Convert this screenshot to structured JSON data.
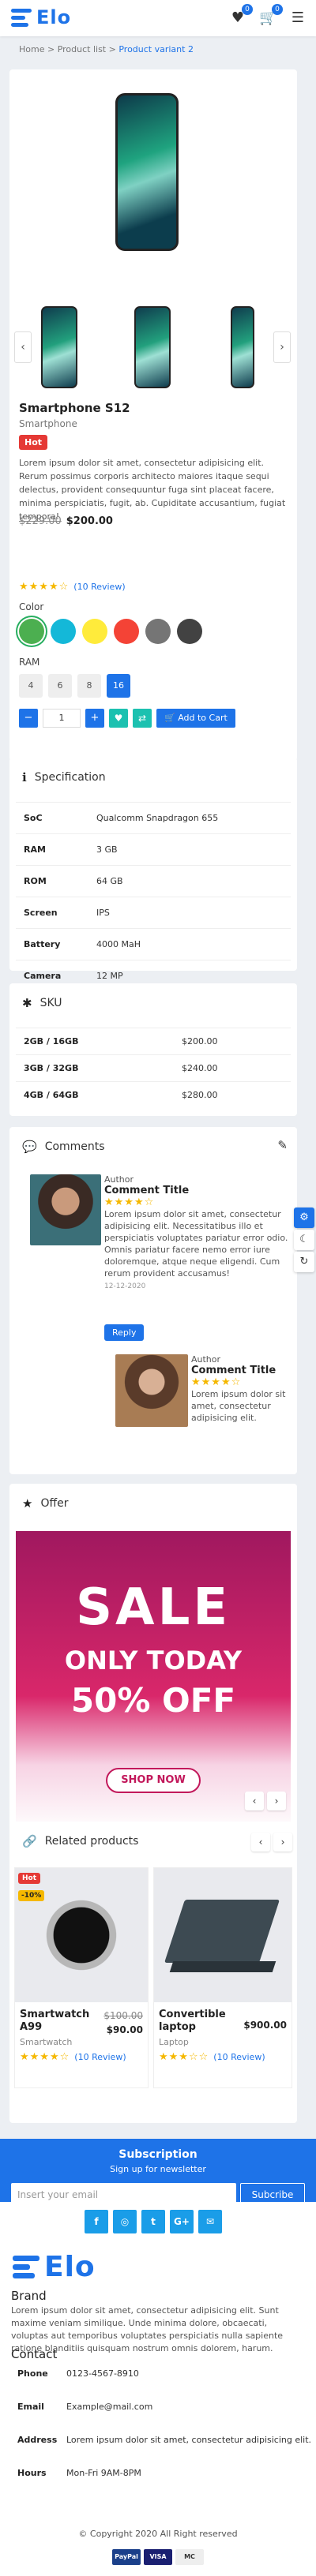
{
  "header": {
    "logo": "Elo",
    "wishlist_count": "0",
    "cart_count": "0"
  },
  "breadcrumb": {
    "home": "Home",
    "list": "Product list",
    "current": "Product variant 2"
  },
  "product": {
    "title": "Smartphone S12",
    "category": "Smartphone",
    "badge": "Hot",
    "description": "Lorem ipsum dolor sit amet, consectetur adipisicing elit. Rerum possimus corporis architecto maiores itaque sequi delectus, provident consequuntur fuga sint placeat facere, minima perspiciatis, fugit, ab. Cupiditate accusantium, fugiat tempora!",
    "old_price": "$229.00",
    "price": "$200.00",
    "rating": 4,
    "reviews": "(10 Review)",
    "color_label": "Color",
    "colors": [
      "#4caf50",
      "#14b8d8",
      "#ffeb3b",
      "#f44336",
      "#757575",
      "#424242"
    ],
    "ram_label": "RAM",
    "ram_options": [
      "4",
      "6",
      "8",
      "16"
    ],
    "ram_selected": "16",
    "quantity": "1",
    "add_to_cart": "Add to Cart"
  },
  "specification": {
    "title": "Specification",
    "rows": [
      {
        "k": "SoC",
        "v": "Qualcomm Snapdragon 655"
      },
      {
        "k": "RAM",
        "v": "3 GB"
      },
      {
        "k": "ROM",
        "v": "64 GB"
      },
      {
        "k": "Screen",
        "v": "IPS"
      },
      {
        "k": "Battery",
        "v": "4000 MaH"
      },
      {
        "k": "Camera",
        "v": "12 MP"
      }
    ]
  },
  "sku": {
    "title": "SKU",
    "rows": [
      {
        "k": "2GB / 16GB",
        "v": "$200.00"
      },
      {
        "k": "3GB / 32GB",
        "v": "$240.00"
      },
      {
        "k": "4GB / 64GB",
        "v": "$280.00"
      }
    ]
  },
  "comments": {
    "title": "Comments",
    "items": [
      {
        "author": "Author",
        "title": "Comment Title",
        "rating": 4,
        "text": "Lorem ipsum dolor sit amet, consectetur adipisicing elit. Necessitatibus illo et perspiciatis voluptates pariatur error odio. Omnis pariatur facere nemo error iure doloremque, atque neque eligendi. Cum rerum provident accusamus!",
        "date": "12-12-2020",
        "reply": "Reply"
      },
      {
        "author": "Author",
        "title": "Comment Title",
        "rating": 4,
        "text": "Lorem ipsum dolor sit amet, consectetur adipisicing elit."
      }
    ]
  },
  "offer": {
    "title": "Offer",
    "line1": "SALE",
    "line2": "ONLY TODAY",
    "line3": "50% OFF",
    "cta": "SHOP NOW"
  },
  "related": {
    "title": "Related products",
    "items": [
      {
        "name": "Smartwatch A99",
        "category": "Smartwatch",
        "old_price": "$100.00",
        "price": "$90.00",
        "rating": 4,
        "reviews": "(10 Review)",
        "badge": "Hot",
        "discount": "-10%"
      },
      {
        "name": "Convertible laptop",
        "category": "Laptop",
        "old_price": "",
        "price": "$900.00",
        "rating": 3,
        "reviews": "(10 Review)",
        "badge": "",
        "discount": ""
      }
    ]
  },
  "subscription": {
    "title": "Subscription",
    "subtitle": "Sign up for newsletter",
    "placeholder": "Insert your email",
    "button": "Subcribe",
    "social": [
      "f",
      "◎",
      "t",
      "G+",
      "✉"
    ]
  },
  "footer": {
    "logo": "Elo",
    "brand_title": "Brand",
    "brand_text": "Lorem ipsum dolor sit amet, consectetur adipisicing elit. Sunt maxime veniam similique. Unde minima dolore, obcaecati, voluptas aut temporibus voluptates perspiciatis nulla sapiente ratione blanditiis quisquam nostrum omnis dolorem, harum.",
    "contact_title": "Contact",
    "contacts": [
      {
        "k": "Phone",
        "v": "0123-4567-8910"
      },
      {
        "k": "Email",
        "v": "Example@mail.com"
      },
      {
        "k": "Address",
        "v": "Lorem ipsum dolor sit amet, consectetur adipisicing elit."
      },
      {
        "k": "Hours",
        "v": "Mon-Fri 9AM-8PM"
      }
    ],
    "copyright": "© Copyright 2020 All Right reserved",
    "payments": [
      "PayPal",
      "VISA",
      "MC"
    ]
  }
}
